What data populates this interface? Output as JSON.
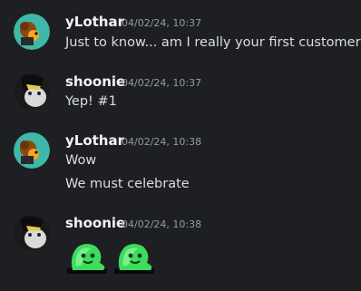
{
  "messages": [
    {
      "author": "yLothar",
      "timestamp": "04/02/24, 10:37",
      "lines": [
        "Just to know... am I really your first customer?"
      ],
      "avatar": "ylothar-avatar"
    },
    {
      "author": "shoonie",
      "timestamp": "04/02/24, 10:37",
      "lines": [
        "Yep! #1"
      ],
      "avatar": "shoonie-avatar"
    },
    {
      "author": "yLothar",
      "timestamp": "04/02/24, 10:38",
      "lines": [
        "Wow",
        "We must celebrate"
      ],
      "avatar": "ylothar-avatar"
    },
    {
      "author": "shoonie",
      "timestamp": "04/02/24, 10:38",
      "lines": [],
      "avatar": "shoonie-avatar",
      "emojis": [
        "green-blob-emoji",
        "green-blob-emoji"
      ]
    }
  ],
  "colors": {
    "background": "#1e1f22",
    "author_text": "#f2f3f5",
    "timestamp_text": "#949ba4",
    "message_text": "#dbdee1",
    "ylothar_avatar_bg": "#3fb8a9",
    "emoji_green": "#3ddc5c"
  }
}
